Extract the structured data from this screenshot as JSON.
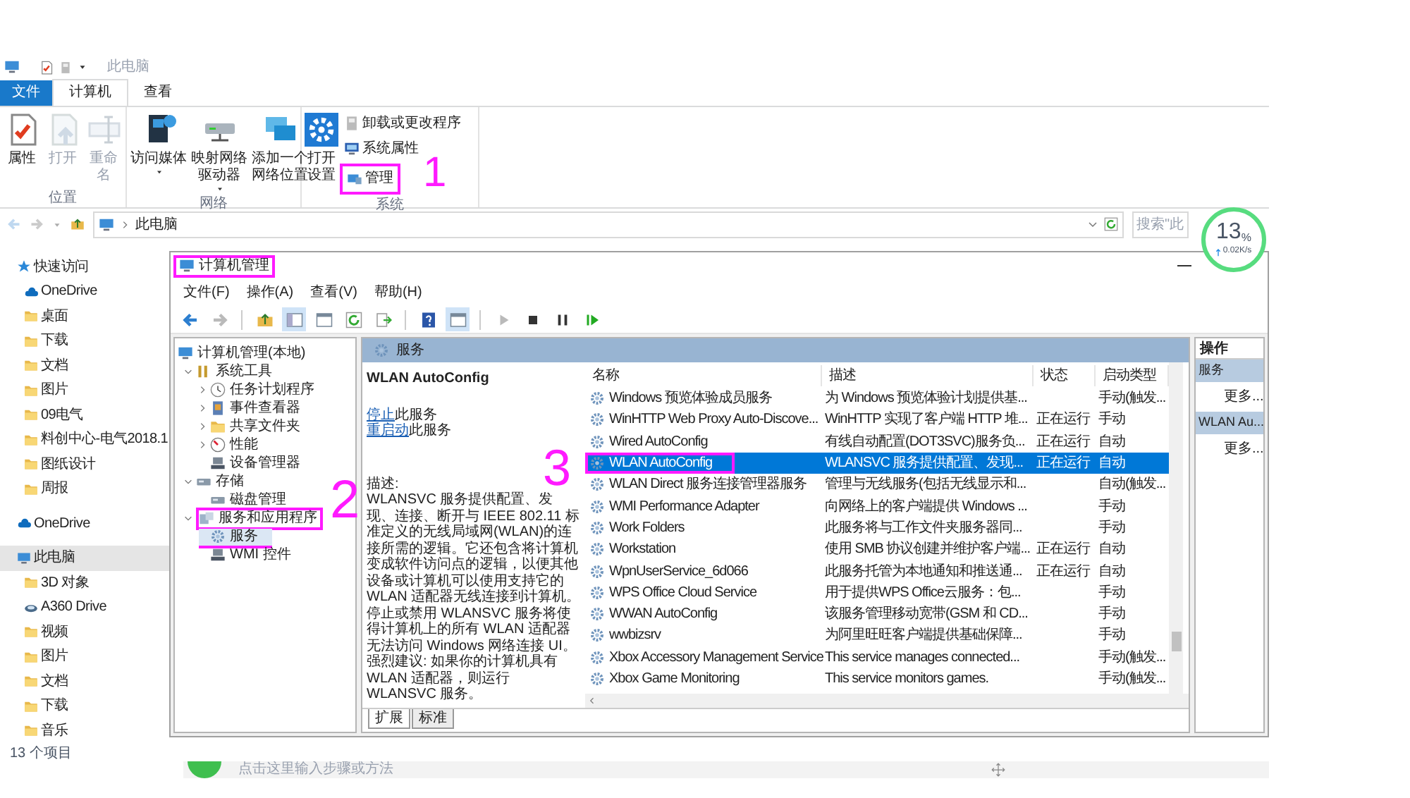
{
  "explorer": {
    "title": "此电脑",
    "ribbon_tabs": [
      {
        "label": "文件",
        "kind": "file",
        "selected": false
      },
      {
        "label": "计算机",
        "kind": "tab",
        "selected": true
      },
      {
        "label": "查看",
        "kind": "tab",
        "selected": false
      }
    ],
    "ribbon_groups": [
      {
        "label": "位置",
        "buttons": [
          {
            "label": "属性",
            "kind": "properties",
            "disabled": false,
            "dropdown": false
          },
          {
            "label": "打开",
            "kind": "open",
            "disabled": true,
            "dropdown": false
          },
          {
            "label": "重命名",
            "kind": "rename",
            "disabled": true,
            "dropdown": false
          }
        ]
      },
      {
        "label": "网络",
        "buttons": [
          {
            "label": "访问媒体",
            "kind": "media",
            "disabled": false,
            "dropdown": true
          },
          {
            "label": "映射网络驱动器",
            "kind": "map-drive",
            "disabled": false,
            "dropdown": true
          },
          {
            "label": "添加一个网络位置",
            "kind": "net-location",
            "disabled": false,
            "dropdown": false
          }
        ]
      },
      {
        "label": "系统",
        "buttons": [
          {
            "label": "打开设置",
            "kind": "settings",
            "disabled": false,
            "dropdown": false
          }
        ],
        "small_buttons": [
          {
            "label": "卸载或更改程序",
            "kind": "uninstall",
            "highlighted": false
          },
          {
            "label": "系统属性",
            "kind": "system",
            "highlighted": false
          },
          {
            "label": "管理",
            "kind": "manage",
            "highlighted": true
          }
        ]
      }
    ],
    "address": {
      "path": "此电脑",
      "search_placeholder": "搜索\"此"
    },
    "nav": [
      {
        "label": "快速访问",
        "kind": "star",
        "selected": false,
        "children": [
          {
            "label": "OneDrive",
            "kind": "cloud",
            "selected": false
          },
          {
            "label": "桌面",
            "kind": "folder",
            "selected": false
          },
          {
            "label": "下载",
            "kind": "folder",
            "selected": false
          },
          {
            "label": "文档",
            "kind": "folder",
            "selected": false
          },
          {
            "label": "图片",
            "kind": "folder",
            "selected": false
          },
          {
            "label": "09电气",
            "kind": "folder",
            "selected": false
          },
          {
            "label": "料创中心-电气2018.1",
            "kind": "folder",
            "selected": false
          },
          {
            "label": "图纸设计",
            "kind": "folder",
            "selected": false
          },
          {
            "label": "周报",
            "kind": "folder",
            "selected": false
          }
        ]
      },
      {
        "label": "OneDrive",
        "kind": "cloud",
        "selected": false
      },
      {
        "label": "此电脑",
        "kind": "computer",
        "selected": true,
        "children": [
          {
            "label": "3D 对象",
            "kind": "folder",
            "selected": false
          },
          {
            "label": "A360 Drive",
            "kind": "drive",
            "selected": false
          },
          {
            "label": "视频",
            "kind": "folder",
            "selected": false
          },
          {
            "label": "图片",
            "kind": "folder",
            "selected": false
          },
          {
            "label": "文档",
            "kind": "folder",
            "selected": false
          },
          {
            "label": "下载",
            "kind": "folder",
            "selected": false
          },
          {
            "label": "音乐",
            "kind": "folder",
            "selected": false
          }
        ]
      }
    ],
    "status": "13 个项目"
  },
  "network_meter": {
    "value": "13",
    "unit": "%",
    "speed": "0.02K/s"
  },
  "step_hint": "点击这里输入步骤或方法",
  "management": {
    "title": "计算机管理",
    "title_highlighted": true,
    "menu": [
      "文件(F)",
      "操作(A)",
      "查看(V)",
      "帮助(H)"
    ],
    "toolbar": [
      {
        "kind": "back",
        "disabled": false,
        "on": false
      },
      {
        "kind": "forward",
        "disabled": true,
        "on": false
      },
      {
        "kind": "up",
        "disabled": false,
        "on": false
      },
      {
        "kind": "tree",
        "disabled": false,
        "on": true
      },
      {
        "kind": "panel",
        "disabled": false,
        "on": false
      },
      {
        "kind": "refresh",
        "disabled": false,
        "on": false
      },
      {
        "kind": "export",
        "disabled": false,
        "on": false
      },
      {
        "kind": "help",
        "disabled": false,
        "on": false
      },
      {
        "kind": "panel",
        "disabled": false,
        "on": true
      },
      {
        "kind": "play",
        "disabled": true,
        "on": false
      },
      {
        "kind": "stop",
        "disabled": false,
        "on": false
      },
      {
        "kind": "pause",
        "disabled": false,
        "on": false
      },
      {
        "kind": "restart",
        "disabled": false,
        "on": false
      }
    ],
    "tree": [
      {
        "label": "计算机管理(本地)",
        "kind": "computer",
        "selected": false,
        "highlighted": false,
        "underlined": false,
        "children": [
          {
            "label": "系统工具",
            "kind": "tools",
            "selected": false,
            "highlighted": false,
            "underlined": false,
            "expanded": true,
            "children": [
              {
                "label": "任务计划程序",
                "kind": "clock",
                "selected": false,
                "highlighted": false,
                "underlined": false,
                "expanded": false
              },
              {
                "label": "事件查看器",
                "kind": "log",
                "selected": false,
                "highlighted": false,
                "underlined": false,
                "expanded": false
              },
              {
                "label": "共享文件夹",
                "kind": "folder",
                "selected": false,
                "highlighted": false,
                "underlined": false,
                "expanded": false
              },
              {
                "label": "性能",
                "kind": "gauge",
                "selected": false,
                "highlighted": false,
                "underlined": false,
                "expanded": false
              },
              {
                "label": "设备管理器",
                "kind": "device",
                "selected": false,
                "highlighted": false,
                "underlined": false
              }
            ]
          },
          {
            "label": "存储",
            "kind": "disk",
            "selected": false,
            "highlighted": false,
            "underlined": false,
            "expanded": true,
            "children": [
              {
                "label": "磁盘管理",
                "kind": "disk",
                "selected": false,
                "highlighted": false,
                "underlined": false
              }
            ]
          },
          {
            "label": "服务和应用程序",
            "kind": "apps",
            "selected": false,
            "highlighted": true,
            "underlined": false,
            "expanded": true,
            "children": [
              {
                "label": "服务",
                "kind": "gear",
                "selected": true,
                "highlighted": false,
                "underlined": true
              },
              {
                "label": "WMI 控件",
                "kind": "device",
                "selected": false,
                "highlighted": false,
                "underlined": false
              }
            ]
          }
        ]
      }
    ],
    "panel_title": "服务",
    "detail": {
      "title": "WLAN AutoConfig",
      "actions": [
        {
          "link": "停止",
          "text": "此服务"
        },
        {
          "link": "重启动",
          "text": "此服务"
        }
      ],
      "description_label": "描述:",
      "description": "WLANSVC 服务提供配置、发现、连接、断开与 IEEE 802.11 标准定义的无线局域网(WLAN)的连接所需的逻辑。它还包含将计算机变成软件访问点的逻辑，以便其他设备或计算机可以使用支持它的 WLAN 适配器无线连接到计算机。停止或禁用 WLANSVC 服务将使得计算机上的所有 WLAN 适配器无法访问 Windows 网络连接 UI。强烈建议: 如果你的计算机具有 WLAN 适配器，则运行 WLANSVC 服务。"
    },
    "columns": [
      "名称",
      "描述",
      "状态",
      "启动类型"
    ],
    "rows": [
      {
        "name": "Windows 预览体验成员服务",
        "description": "为 Windows 预览体验计划提供基...",
        "startup": "手动(触发...",
        "selected": false,
        "highlighted": false
      },
      {
        "name": "WinHTTP Web Proxy Auto-Discove...",
        "description": "WinHTTP 实现了客户端 HTTP 堆...",
        "status": "正在运行",
        "startup": "手动",
        "selected": false,
        "highlighted": false
      },
      {
        "name": "Wired AutoConfig",
        "description": "有线自动配置(DOT3SVC)服务负...",
        "status": "正在运行",
        "startup": "自动",
        "selected": false,
        "highlighted": false
      },
      {
        "name": "WLAN AutoConfig",
        "description": "WLANSVC 服务提供配置、发现...",
        "status": "正在运行",
        "startup": "自动",
        "selected": true,
        "highlighted": true
      },
      {
        "name": "WLAN Direct 服务连接管理器服务",
        "description": "管理与无线服务(包括无线显示和...",
        "startup": "自动(触发...",
        "selected": false,
        "highlighted": false
      },
      {
        "name": "WMI Performance Adapter",
        "description": "向网络上的客户端提供 Windows ...",
        "startup": "手动",
        "selected": false,
        "highlighted": false
      },
      {
        "name": "Work Folders",
        "description": "此服务将与工作文件夹服务器同...",
        "startup": "手动",
        "selected": false,
        "highlighted": false
      },
      {
        "name": "Workstation",
        "description": "使用 SMB 协议创建并维护客户端...",
        "status": "正在运行",
        "startup": "自动",
        "selected": false,
        "highlighted": false
      },
      {
        "name": "WpnUserService_6d066",
        "description": "此服务托管为本地通知和推送通...",
        "status": "正在运行",
        "startup": "自动",
        "selected": false,
        "highlighted": false
      },
      {
        "name": "WPS Office Cloud Service",
        "description": "用于提供WPS Office云服务：包...",
        "startup": "手动",
        "selected": false,
        "highlighted": false
      },
      {
        "name": "WWAN AutoConfig",
        "description": "该服务管理移动宽带(GSM 和 CD...",
        "startup": "手动",
        "selected": false,
        "highlighted": false
      },
      {
        "name": "wwbizsrv",
        "description": "为阿里旺旺客户端提供基础保障...",
        "startup": "手动",
        "selected": false,
        "highlighted": false
      },
      {
        "name": "Xbox Accessory Management Service",
        "description": "This service manages connected...",
        "startup": "手动(触发...",
        "selected": false,
        "highlighted": false
      },
      {
        "name": "Xbox Game Monitoring",
        "description": "This service monitors games.",
        "startup": "手动(触发...",
        "selected": false,
        "highlighted": false
      }
    ],
    "view_tabs": [
      {
        "label": "扩展",
        "selected": true
      },
      {
        "label": "标准",
        "selected": false
      }
    ],
    "actions_pane": {
      "title": "操作",
      "sections": [
        {
          "title": "服务",
          "items": [
            "更多..."
          ]
        },
        {
          "title": "WLAN Au...",
          "items": [
            "更多..."
          ]
        }
      ]
    }
  },
  "annotations": [
    "1",
    "2",
    "3"
  ]
}
